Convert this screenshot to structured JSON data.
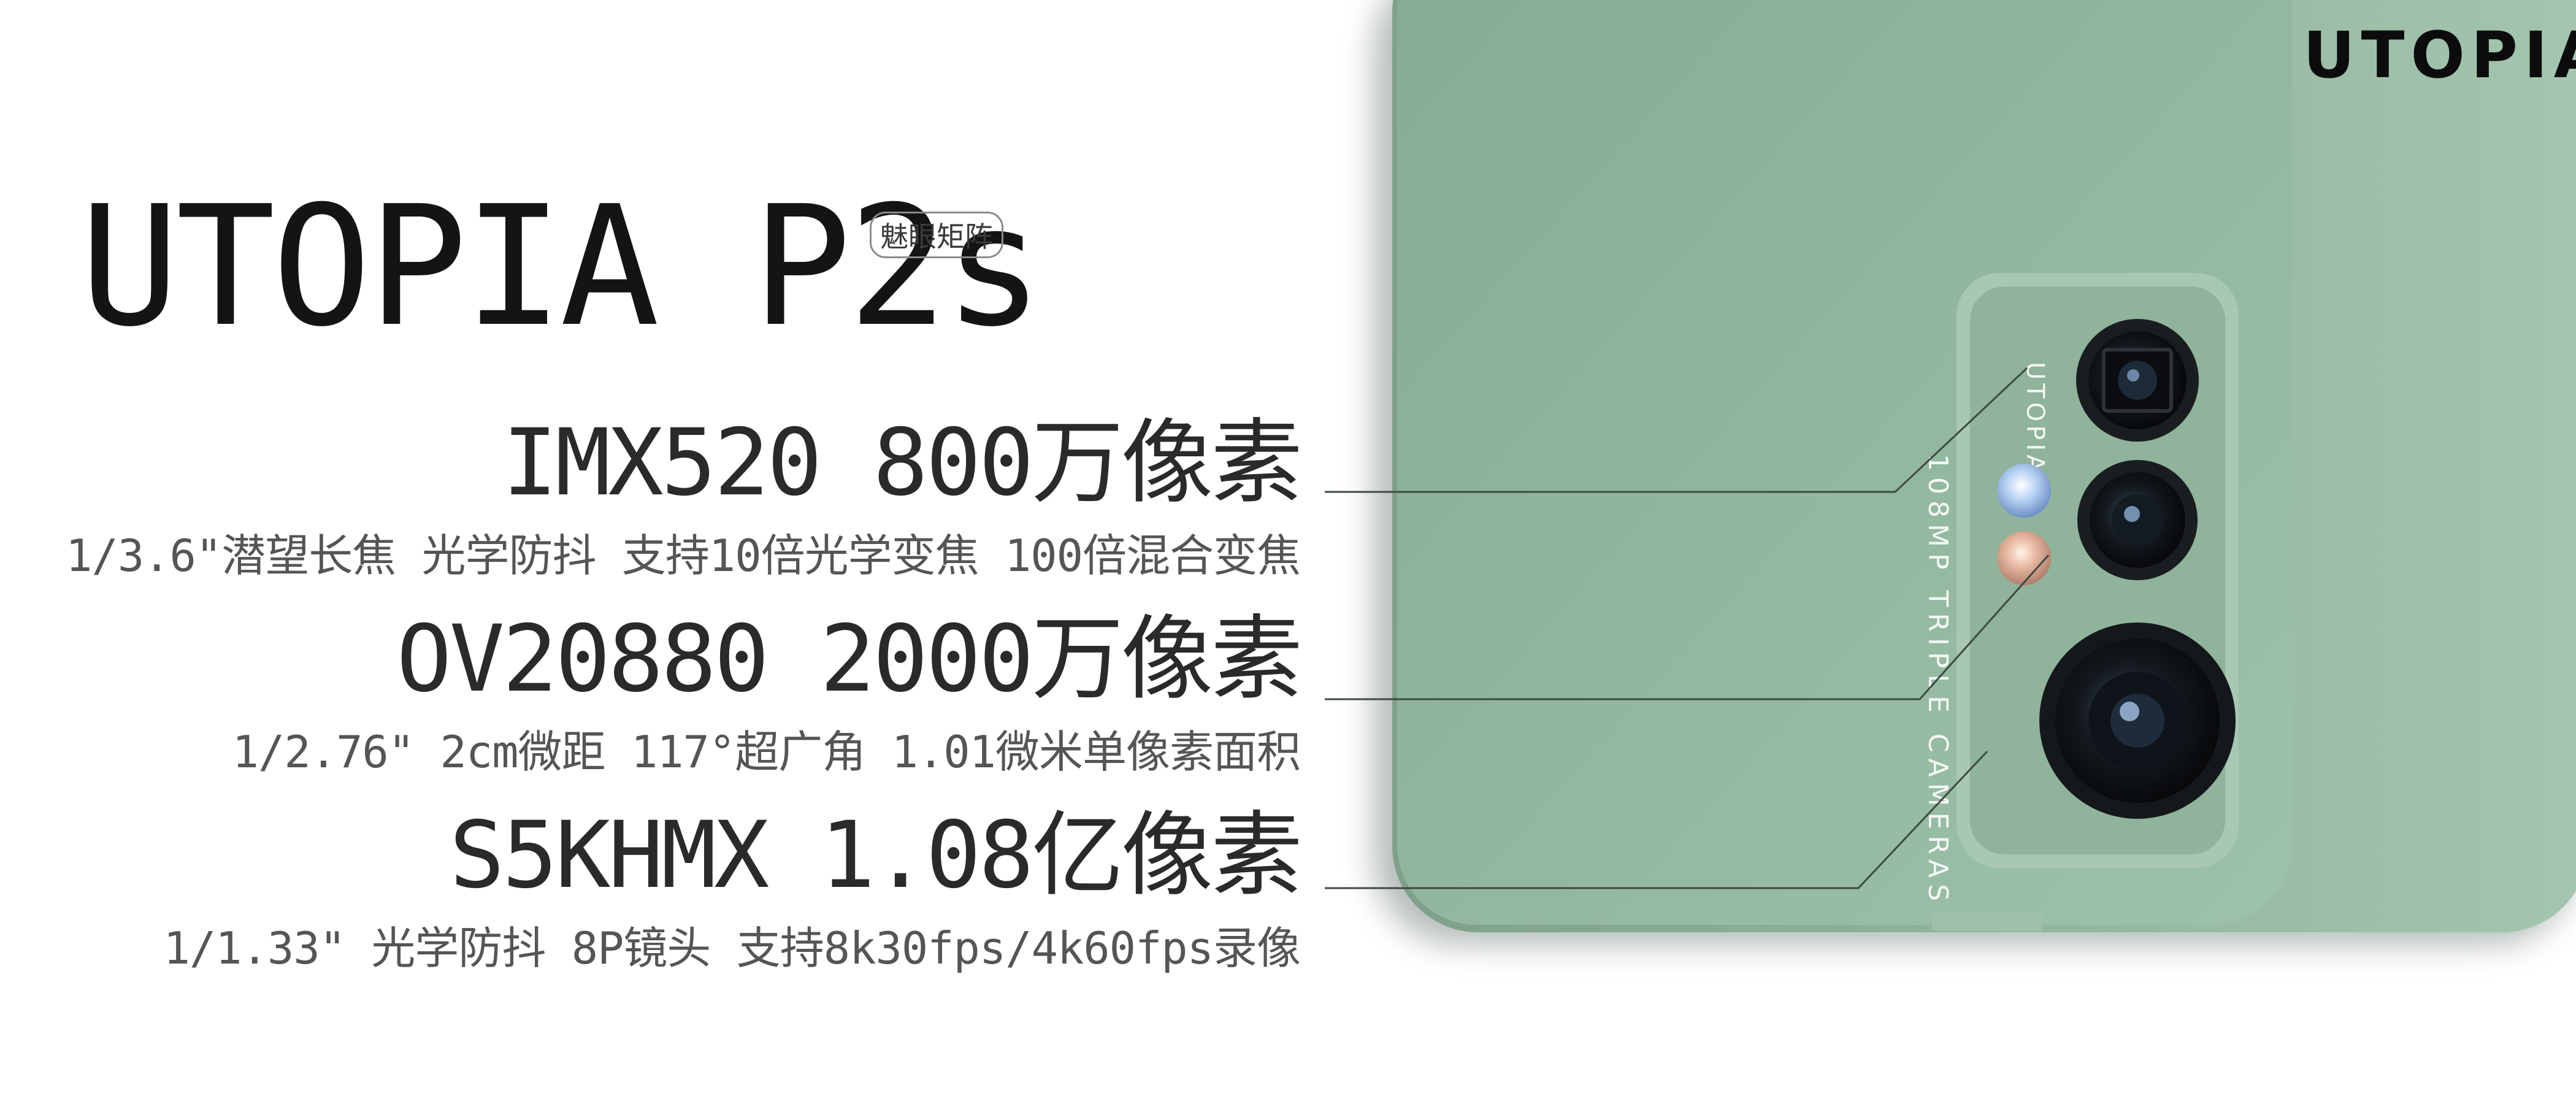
{
  "product": {
    "title": "UTOPIA P2s",
    "tag": "魅眼矩阵"
  },
  "brand": {
    "logo_text": "UTOPIA"
  },
  "cameras": [
    {
      "name": "IMX520 800万像素",
      "details": "1/3.6\"潜望长焦 光学防抖 支持10倍光学变焦 100倍混合变焦"
    },
    {
      "name": "OV20880 2000万像素",
      "details": "1/2.76\" 2cm微距 117°超广角 1.01微米单像素面积"
    },
    {
      "name": "S5KHMX 1.08亿像素",
      "details": "1/1.33\" 光学防抖 8P镜头 支持8k30fps/4k60fps录像"
    }
  ],
  "phone": {
    "body_color": "#8fb59d",
    "module_brand": "UTOPIA",
    "module_text": "108MP TRIPLE CAMERAS"
  },
  "icons": {
    "logo": "utopia-logo-icon",
    "lens": "camera-lens-icon",
    "flash": "flash-icon"
  }
}
